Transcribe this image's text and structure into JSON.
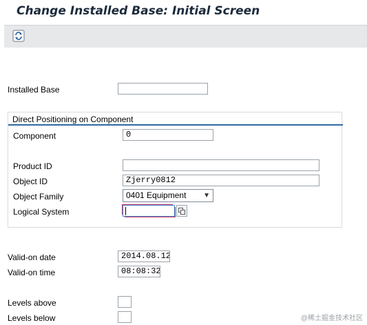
{
  "title": "Change Installed Base: Initial Screen",
  "toolbar": {
    "icon": "refresh-icon"
  },
  "form": {
    "installed_base_label": "Installed Base",
    "installed_base_value": ""
  },
  "group": {
    "title": "Direct Positioning on Component",
    "component_label": "Component",
    "component_value": "0",
    "product_id_label": "Product ID",
    "product_id_value": "",
    "object_id_label": "Object ID",
    "object_id_value": "Zjerry0812",
    "object_family_label": "Object Family",
    "object_family_value": "0401 Equipment",
    "logical_system_label": "Logical System",
    "logical_system_value": ""
  },
  "validity": {
    "date_label": "Valid-on date",
    "date_value": "2014.08.12",
    "time_label": "Valid-on time",
    "time_value": "08:08:32"
  },
  "levels": {
    "above_label": "Levels above",
    "above_value": "",
    "below_label": "Levels below",
    "below_value": ""
  },
  "watermark": "@稀土掘金技术社区",
  "colors": {
    "title": "#1c2b3c",
    "toolbar_bg": "#e7e8ea",
    "group_line": "#2f6aa3",
    "required_border": "#c0306a"
  }
}
